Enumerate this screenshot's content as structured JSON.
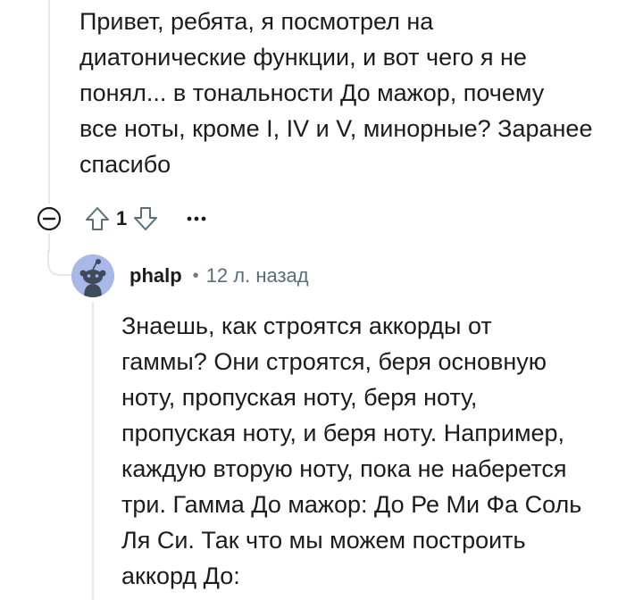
{
  "parent_comment": {
    "lines": [
      "Привет, ребята, я посмотрел на",
      "диатонические функции, и вот чего я не",
      "понял... в тональности До мажор, почему",
      "все ноты, кроме I, IV и V, минорные? Заранее",
      "спасибо"
    ],
    "vote_count": "1"
  },
  "reply": {
    "author": "phalp",
    "separator": "•",
    "time": "12 л. назад",
    "lines": [
      "Знаешь, как строятся аккорды от",
      "гаммы? Они строятся, беря основную",
      "ноту, пропуская ноту, беря ноту,",
      "пропуская ноту, и беря ноту. Например,",
      "каждую вторую ноту, пока не наберется",
      "три. Гамма До мажор: До Ре Ми Фа Соль",
      "Ля Си. Так что мы можем построить",
      "аккорд До:"
    ]
  },
  "icons": {
    "collapse": "collapse-minus-icon",
    "upvote": "upvote-arrow-icon",
    "downvote": "downvote-arrow-icon",
    "more": "ellipsis-icon",
    "avatar": "snoo-avatar-icon"
  },
  "colors": {
    "text": "#1c1c1c",
    "meta": "#576f76",
    "thread_line": "#e5e8eb",
    "avatar_bg": "#a8b8e8",
    "snoo": "#3f4a5a"
  }
}
